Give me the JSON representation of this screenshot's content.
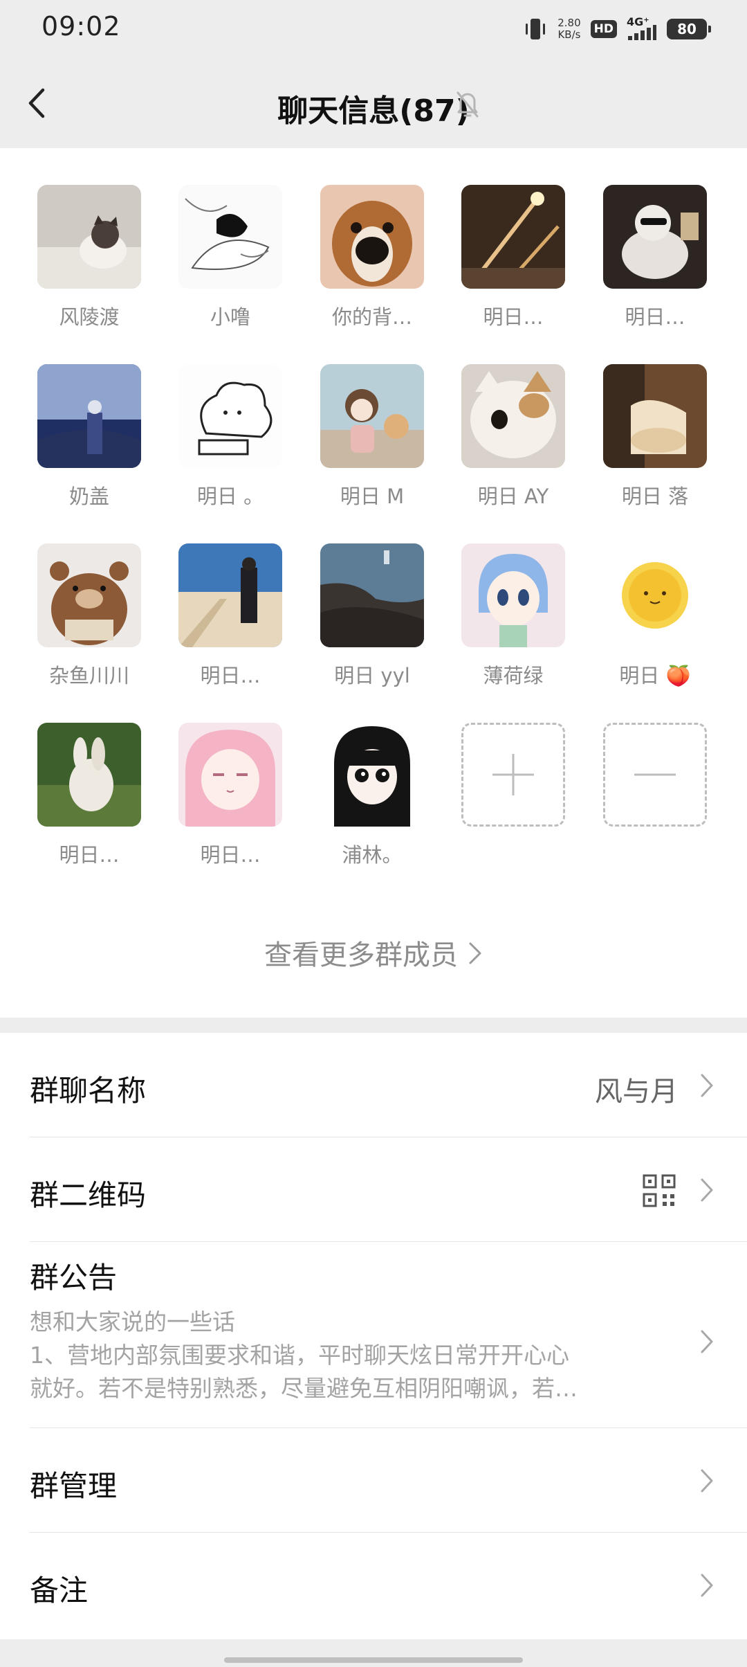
{
  "status_bar": {
    "time": "09:02",
    "net_speed_value": "2.80",
    "net_speed_unit": "KB/s",
    "hd": "HD",
    "network": "4G⁺",
    "battery": "80",
    "icons": [
      "vibrate-icon",
      "signal-icon",
      "battery-icon"
    ]
  },
  "nav": {
    "title": "聊天信息(87)",
    "back_icon": "chevron-left-icon",
    "mute_icon": "bell-off-icon"
  },
  "members": [
    {
      "name": "风陵渡"
    },
    {
      "name": "小噜"
    },
    {
      "name": "你的背…"
    },
    {
      "name": "明日…"
    },
    {
      "name": "明日…"
    },
    {
      "name": "奶盖"
    },
    {
      "name": "明日 。"
    },
    {
      "name": "明日 M"
    },
    {
      "name": "明日 AY"
    },
    {
      "name": "明日 落"
    },
    {
      "name": "杂鱼川川"
    },
    {
      "name": "明日…"
    },
    {
      "name": "明日 yyl"
    },
    {
      "name": "薄荷绿"
    },
    {
      "name": "明日 🍑"
    },
    {
      "name": "明日…"
    },
    {
      "name": "明日…"
    },
    {
      "name": "浦林。"
    }
  ],
  "more_members": "查看更多群成员",
  "settings": {
    "group_name_label": "群聊名称",
    "group_name_value": "风与月",
    "qr_label": "群二维码",
    "notice_label": "群公告",
    "notice_lines": [
      "想和大家说的一些话",
      "1、营地内部氛围要求和谐，平时聊天炫日常开开心心",
      "就好。若不是特别熟悉，尽量避免互相阴阳嘲讽，若…"
    ],
    "manage_label": "群管理",
    "remark_label": "备注"
  }
}
